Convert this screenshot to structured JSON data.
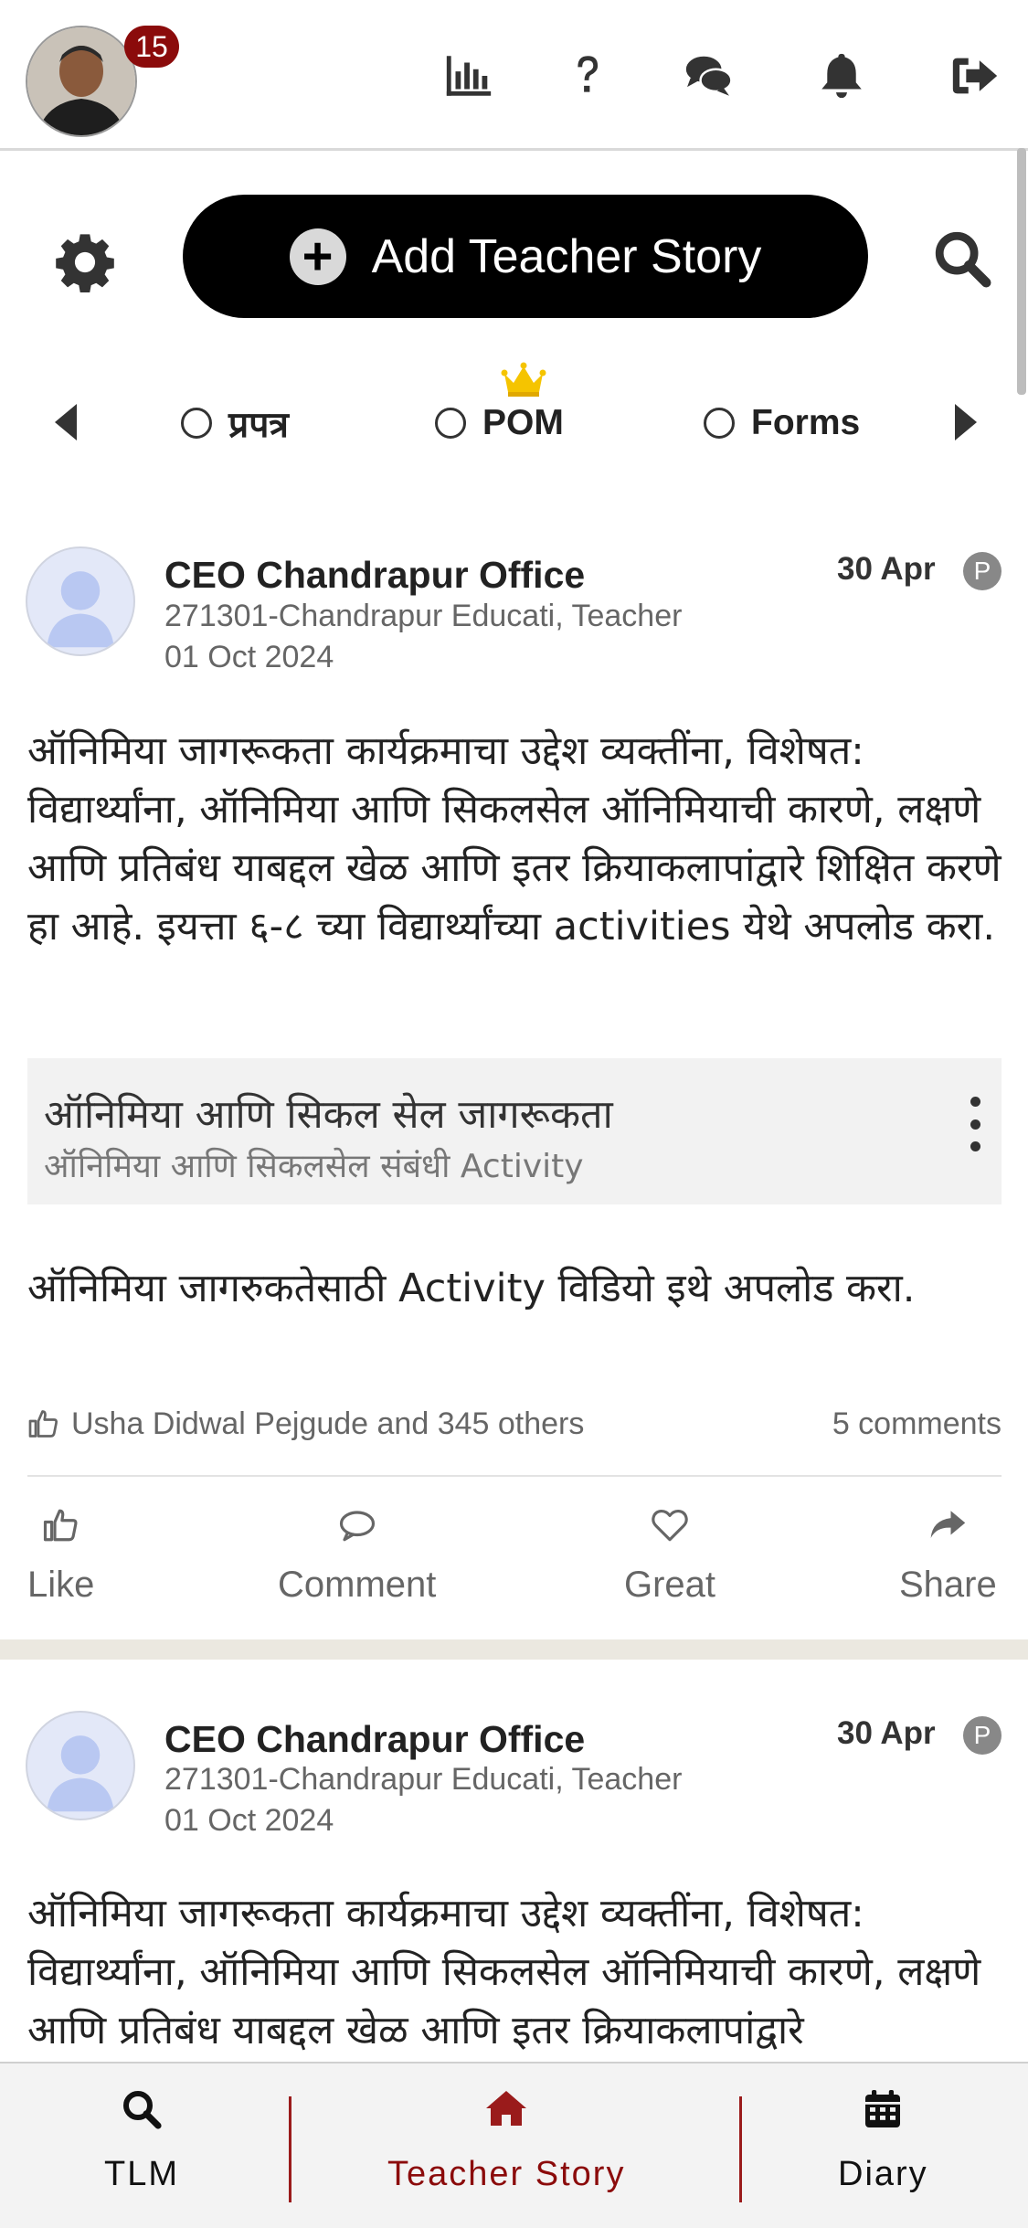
{
  "topbar": {
    "notification_count": "15",
    "icons": [
      "bar-chart-icon",
      "question-icon",
      "chat-icon",
      "bell-icon",
      "logout-icon"
    ]
  },
  "actions": {
    "add_story_label": "Add Teacher Story"
  },
  "filters": {
    "items": [
      {
        "label": "प्रपत्र",
        "selected": false
      },
      {
        "label": "POM",
        "selected": false,
        "crown": true
      },
      {
        "label": "Forms",
        "selected": false
      }
    ]
  },
  "posts": [
    {
      "author": "CEO Chandrapur Office",
      "role": "271301-Chandrapur Educati, Teacher",
      "posted_date": "01 Oct 2024",
      "date": "30 Apr",
      "badge": "P",
      "body": "ऑनिमिया जागरूकता कार्यक्रमाचा उद्देश व्यक्तींना, विशेषत: विद्यार्थ्यांना, ऑनिमिया आणि सिकलसेल ऑनिमियाची कारणे, लक्षणे आणि प्रतिबंध याबद्दल खेळ आणि इतर क्रियाकलापांद्वारे शिक्षित करणे हा आहे. इयत्ता ६-८ च्या विद्यार्थ्यांच्या activities येथे अपलोड करा.",
      "attachment_title": "ऑनिमिया आणि सिकल सेल जागरूकता",
      "attachment_subtitle": "ऑनिमिया आणि सिकलसेल संबंधी Activity",
      "note": "ऑनिमिया जागरुकतेसाठी Activity विडियो इथे अपलोड करा.",
      "likes_text": "Usha Didwal Pejgude and 345 others",
      "comments_text": "5 comments",
      "actions": {
        "like": "Like",
        "comment": "Comment",
        "great": "Great",
        "share": "Share"
      }
    },
    {
      "author": "CEO Chandrapur Office",
      "role": "271301-Chandrapur Educati, Teacher",
      "posted_date": "01 Oct 2024",
      "date": "30 Apr",
      "badge": "P",
      "body": "ऑनिमिया जागरूकता कार्यक्रमाचा उद्देश व्यक्तींना, विशेषत: विद्यार्थ्यांना, ऑनिमिया आणि सिकलसेल ऑनिमियाची कारणे, लक्षणे आणि प्रतिबंध याबद्दल खेळ आणि इतर क्रियाकलापांद्वारे"
    }
  ],
  "bottom_nav": {
    "items": [
      {
        "label": "TLM",
        "icon": "search-icon",
        "active": false
      },
      {
        "label": "Teacher Story",
        "icon": "home-icon",
        "active": true
      },
      {
        "label": "Diary",
        "icon": "calendar-icon",
        "active": false
      }
    ]
  },
  "colors": {
    "accent": "#8b0b0b",
    "badge_bg": "#8b0b0b",
    "primary_button": "#000000",
    "crown": "#f5c400"
  }
}
